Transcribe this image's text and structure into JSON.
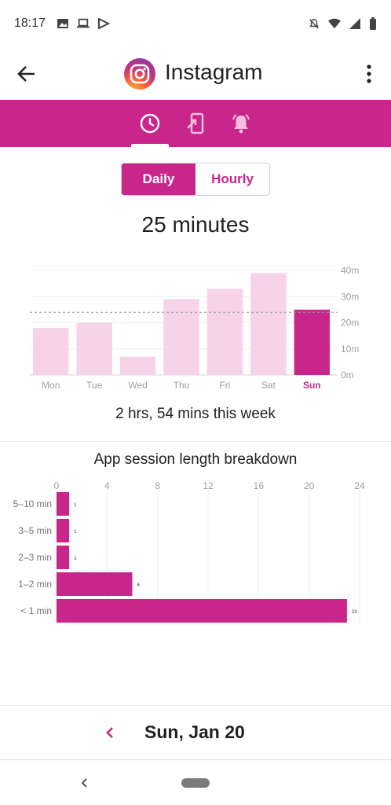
{
  "status_bar": {
    "time": "18:17",
    "left_icons": [
      "image-icon",
      "laptop-icon",
      "play-store-icon"
    ],
    "right_icons": [
      "notifications-off-icon",
      "wifi-icon",
      "signal-icon",
      "battery-icon"
    ]
  },
  "app_bar": {
    "title": "Instagram",
    "back_icon": "arrow-back-icon",
    "menu_icon": "more-vert-icon"
  },
  "tabs": [
    {
      "icon": "clock-icon",
      "selected": true
    },
    {
      "icon": "phone-unlock-icon",
      "selected": false
    },
    {
      "icon": "bell-icon",
      "selected": false
    }
  ],
  "toggle": {
    "daily": "Daily",
    "hourly": "Hourly",
    "selected": "daily"
  },
  "total_label": "25 minutes",
  "week_label": "2 hrs, 54 mins this week",
  "breakdown_title": "App session length breakdown",
  "date_nav": {
    "label": "Sun, Jan 20",
    "prev_icon": "chevron-left-icon"
  },
  "colors": {
    "accent": "#c9268b",
    "bar_light": "#f6d3e8",
    "bar_selected": "#c9268b"
  },
  "chart_data": [
    {
      "type": "bar",
      "categories": [
        "Mon",
        "Tue",
        "Wed",
        "Thu",
        "Fri",
        "Sat",
        "Sun"
      ],
      "values": [
        18,
        20,
        7,
        29,
        33,
        39,
        25
      ],
      "selected_index": 6,
      "ytick_labels": [
        "0m",
        "10m",
        "20m",
        "30m",
        "40m"
      ],
      "ylim": [
        0,
        40
      ],
      "average_line": 24,
      "grid": true
    },
    {
      "type": "bar",
      "orientation": "horizontal",
      "categories": [
        "5–10 min",
        "3–5 min",
        "2–3 min",
        "1–2 min",
        "< 1 min"
      ],
      "values": [
        1,
        1,
        1,
        6,
        23
      ],
      "xticks": [
        0,
        4,
        8,
        12,
        16,
        20,
        24
      ],
      "xlim": [
        0,
        24
      ],
      "grid": true
    }
  ]
}
